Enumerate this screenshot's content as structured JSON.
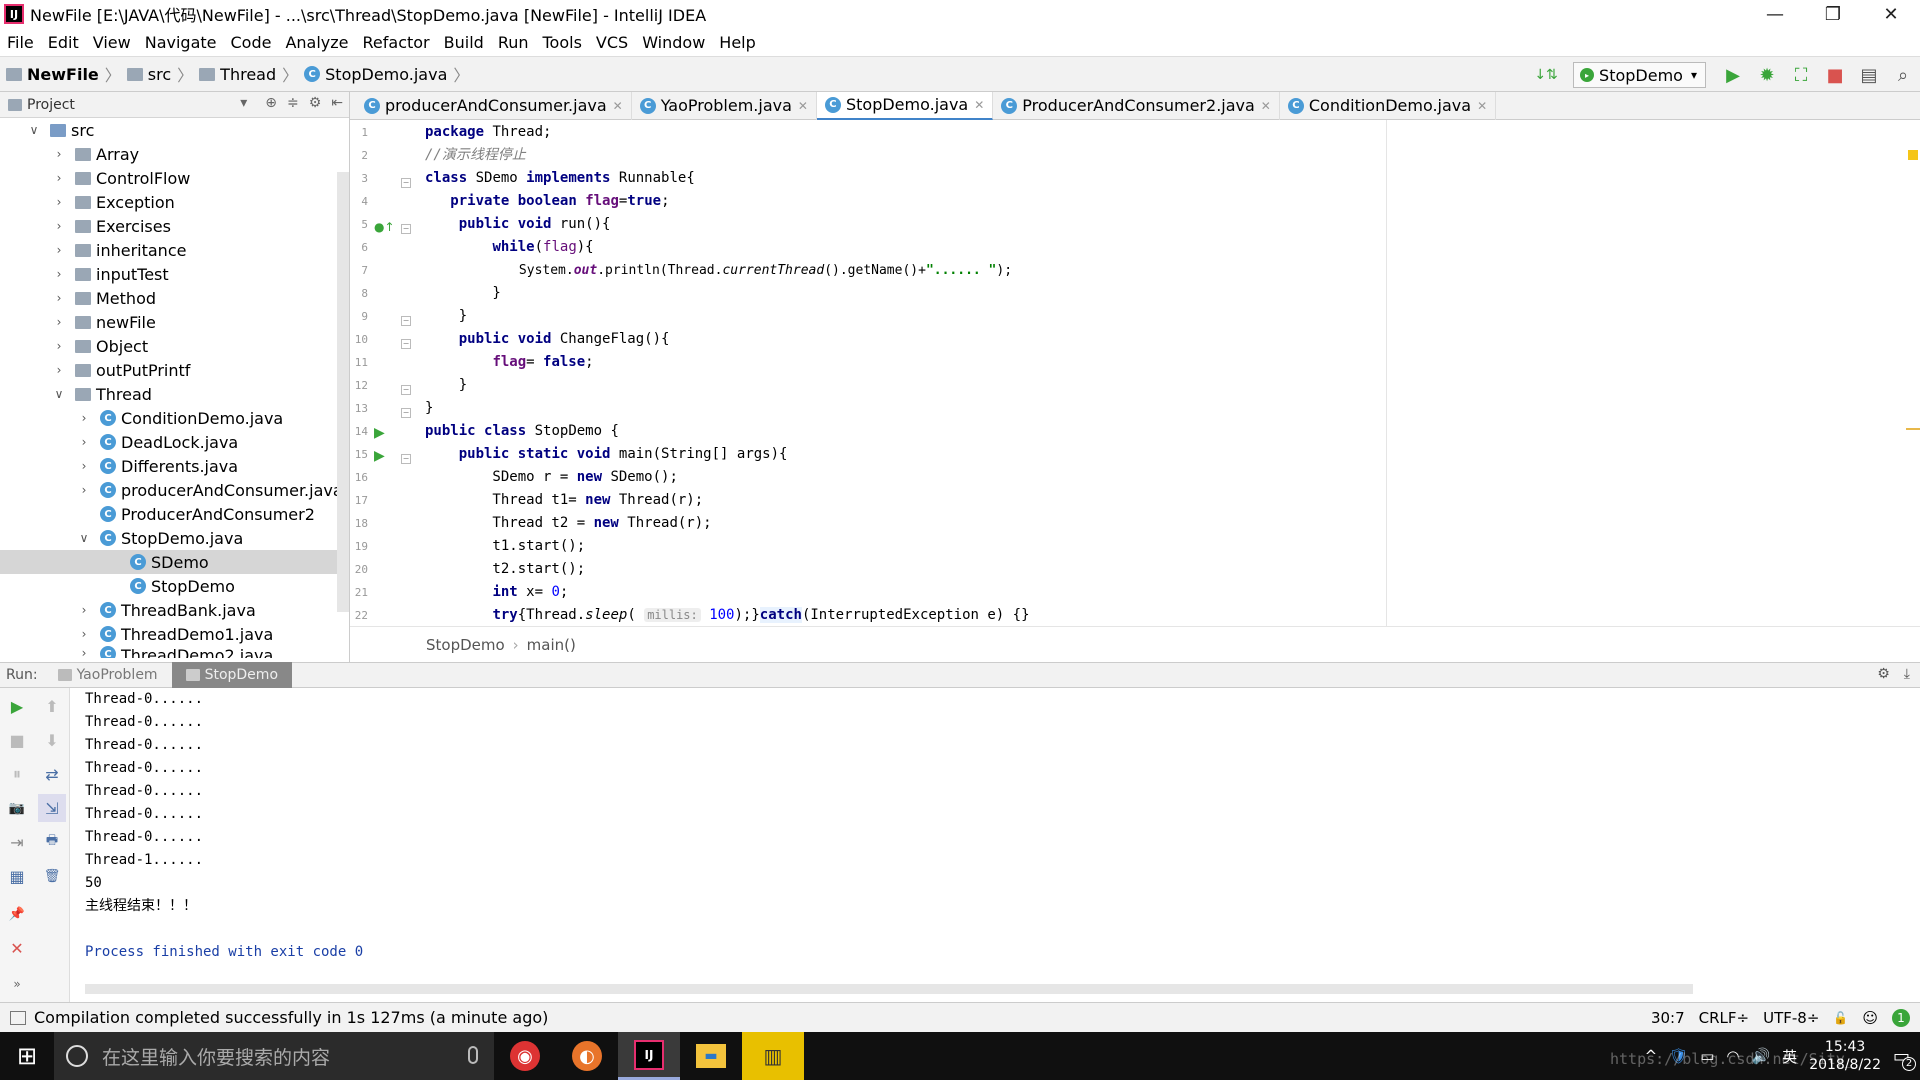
{
  "window": {
    "title": "NewFile [E:\\JAVA\\代码\\NewFile] - ...\\src\\Thread\\StopDemo.java [NewFile] - IntelliJ IDEA",
    "logo_text": "IJ",
    "min": "—",
    "max": "❐",
    "close": "✕"
  },
  "menu": [
    "File",
    "Edit",
    "View",
    "Navigate",
    "Code",
    "Analyze",
    "Refactor",
    "Build",
    "Run",
    "Tools",
    "VCS",
    "Window",
    "Help"
  ],
  "breadcrumbs": [
    "NewFile",
    "src",
    "Thread",
    "StopDemo.java"
  ],
  "toolbar": {
    "run_config": "StopDemo",
    "run_config_arrow": "▾",
    "sort_icon": "↓⇅",
    "run_icon": "▶",
    "debug_icon": "✹",
    "coverage_icon": "⛶",
    "stop_icon": "■",
    "structure_icon": "▤",
    "search_icon": "⌕"
  },
  "project_panel": {
    "title": "Project",
    "dropdown": "▾",
    "icons": [
      "⊕",
      "≑",
      "⚙",
      "⇤"
    ],
    "tree": [
      {
        "label": "src",
        "expanded": true
      },
      {
        "label": "Array"
      },
      {
        "label": "ControlFlow"
      },
      {
        "label": "Exception"
      },
      {
        "label": "Exercises"
      },
      {
        "label": "inheritance"
      },
      {
        "label": "inputTest"
      },
      {
        "label": "Method"
      },
      {
        "label": "newFile"
      },
      {
        "label": "Object"
      },
      {
        "label": "outPutPrintf"
      },
      {
        "label": "Thread",
        "expanded": true
      },
      {
        "label": "ConditionDemo.java"
      },
      {
        "label": "DeadLock.java"
      },
      {
        "label": "Differents.java"
      },
      {
        "label": "producerAndConsumer.java"
      },
      {
        "label": "ProducerAndConsumer2"
      },
      {
        "label": "StopDemo.java",
        "expanded": true
      },
      {
        "label": "SDemo",
        "selected": true
      },
      {
        "label": "StopDemo"
      },
      {
        "label": "ThreadBank.java"
      },
      {
        "label": "ThreadDemo1.java"
      },
      {
        "label": "ThreadDemo2.java"
      }
    ]
  },
  "editor_tabs": [
    {
      "label": "producerAndConsumer.java",
      "active": false
    },
    {
      "label": "YaoProblem.java",
      "active": false
    },
    {
      "label": "StopDemo.java",
      "active": true
    },
    {
      "label": "ProducerAndConsumer2.java",
      "active": false
    },
    {
      "label": "ConditionDemo.java",
      "active": false
    }
  ],
  "tab_close": "✕",
  "line_numbers": [
    "1",
    "2",
    "3",
    "4",
    "5",
    "6",
    "7",
    "8",
    "9",
    "10",
    "11",
    "12",
    "13",
    "14",
    "15",
    "16",
    "17",
    "18",
    "19",
    "20",
    "21",
    "22"
  ],
  "code": {
    "l1_kw": "package",
    "l1_rest": " Thread;",
    "l2": "//演示线程停止",
    "l3_kw1": "class",
    "l3_mid": " SDemo ",
    "l3_kw2": "implements",
    "l3_rest": " Runnable{",
    "l4_pre": "   ",
    "l4_kw1": "private",
    "l4_sp": " ",
    "l4_kw2": "boolean",
    "l4_sp2": " ",
    "l4_field": "flag",
    "l4_eq": "=",
    "l4_kw3": "true",
    "l4_end": ";",
    "l5_pre": "    ",
    "l5_kw1": "public",
    "l5_sp": " ",
    "l5_kw2": "void",
    "l5_rest": " run(){",
    "l6_pre": "        ",
    "l6_kw": "while",
    "l6_a": "(",
    "l6_field": "flag",
    "l6_b": "){",
    "l7_pre": "            System.",
    "l7_out": "out",
    "l7_mid": ".println(Thread.",
    "l7_it": "currentThread",
    "l7_mid2": "().getName()+",
    "l7_str": "\"...... \"",
    "l7_end": ");",
    "l8": "        }",
    "l9": "    }",
    "l10_pre": "    ",
    "l10_kw1": "public",
    "l10_sp": " ",
    "l10_kw2": "void",
    "l10_rest": " ChangeFlag(){",
    "l11_pre": "        ",
    "l11_field": "flag",
    "l11_eq": "= ",
    "l11_kw": "false",
    "l11_end": ";",
    "l12": "    }",
    "l13": "}",
    "l14_kw1": "public",
    "l14_sp": " ",
    "l14_kw2": "class",
    "l14_rest": " StopDemo {",
    "l15_pre": "    ",
    "l15_kw1": "public",
    "l15_sp": " ",
    "l15_kw2": "static",
    "l15_sp2": " ",
    "l15_kw3": "void",
    "l15_rest": " main(String[] args){",
    "l16_pre": "        SDemo r = ",
    "l16_kw": "new",
    "l16_rest": " SDemo();",
    "l17_pre": "        Thread t1= ",
    "l17_kw": "new",
    "l17_rest": " Thread(r);",
    "l18_pre": "        Thread t2 = ",
    "l18_kw": "new",
    "l18_rest": " Thread(r);",
    "l19": "        t1.start();",
    "l20": "        t2.start();",
    "l21_pre": "        ",
    "l21_kw": "int",
    "l21_rest": " x= ",
    "l21_num": "0",
    "l21_end": ";",
    "l22_pre": "        ",
    "l22_kw": "try",
    "l22_a": "{Thread.",
    "l22_it": "sleep",
    "l22_b": "( ",
    "l22_hint": "millis:",
    "l22_num": " 100",
    "l22_c": ");}",
    "l22_kw2": "catch",
    "l22_d": "(InterruptedException e) {}"
  },
  "editor_breadcrumb": [
    "StopDemo",
    "main()"
  ],
  "run_panel": {
    "label": "Run:",
    "tabs": [
      {
        "label": "YaoProblem",
        "active": false
      },
      {
        "label": "StopDemo",
        "active": true
      }
    ],
    "header_icons": [
      "⚙",
      "⤓"
    ],
    "side_icons": [
      "▶",
      "■",
      "⏸",
      "📷",
      "⇥",
      "▦",
      "📌",
      "✕",
      "»",
      "⬆",
      "⬇",
      "⇄",
      "⇲",
      "🖶",
      "🗑"
    ],
    "console": [
      "Thread-0......",
      "Thread-0......",
      "Thread-0......",
      "Thread-0......",
      "Thread-0......",
      "Thread-0......",
      "Thread-0......",
      "Thread-1......",
      "50",
      "主线程结束！！！",
      "",
      "Process finished with exit code 0"
    ]
  },
  "status": {
    "message": "Compilation completed successfully in 1s 127ms (a minute ago)",
    "position": "30:7",
    "line_sep": "CRLF÷",
    "encoding": "UTF-8÷",
    "lock_icon": "🔓",
    "inspector_icon": "☺",
    "notifications": "1"
  },
  "taskbar": {
    "start_icon": "⊞",
    "search_placeholder": "在这里输入你要搜索的内容",
    "apps": [
      "netease-music",
      "browser",
      "intellij",
      "explorer",
      "charts"
    ],
    "app_glyphs": [
      "◉",
      "◐",
      "IJ",
      "▬",
      "▥"
    ],
    "tray_icons": [
      "^",
      "🛡",
      "▭",
      "◠",
      "🔊"
    ],
    "ime": "英",
    "time": "15:43",
    "date": "2018/8/22",
    "watermark": "https://blog.csdn.net/Sity_",
    "notification_badge": "2"
  },
  "colors": {
    "accent": "#4083c9",
    "run_green": "#3aa53a",
    "stop_red": "#d9534f",
    "keyword": "#000080",
    "string": "#008000",
    "field": "#660e7a",
    "console_blue": "#1a3fa6"
  }
}
